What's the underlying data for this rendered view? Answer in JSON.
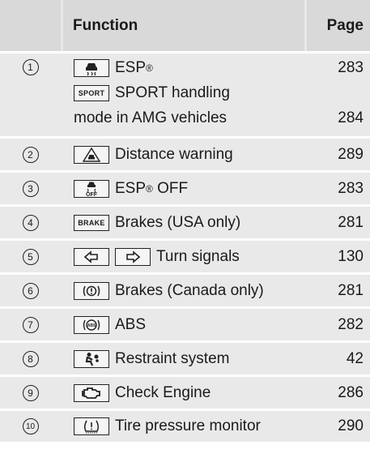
{
  "header": {
    "function": "Function",
    "page": "Page"
  },
  "rows": [
    {
      "num": "1",
      "lines": [
        {
          "icon": "esp-car-icon",
          "text": "ESP",
          "sup": "®"
        },
        {
          "icon": "sport-text-icon",
          "icon_text": "SPORT",
          "text": "SPORT handling"
        },
        {
          "text": "mode in AMG vehicles"
        }
      ],
      "pages": [
        "283",
        "284"
      ]
    },
    {
      "num": "2",
      "text": "Distance warning",
      "page": "289",
      "icon": "distance-warning-icon"
    },
    {
      "num": "3",
      "text": "ESP",
      "sup": "®",
      "text2": " OFF",
      "page": "283",
      "icon": "esp-off-icon"
    },
    {
      "num": "4",
      "text": "Brakes (USA only)",
      "page": "281",
      "icon": "brake-text-icon",
      "icon_text": "BRAKE"
    },
    {
      "num": "5",
      "text": "Turn signals",
      "page": "130",
      "icon": "turn-signal-icons"
    },
    {
      "num": "6",
      "text": "Brakes (Canada only)",
      "page": "281",
      "icon": "brake-circle-icon"
    },
    {
      "num": "7",
      "text": "ABS",
      "page": "282",
      "icon": "abs-icon",
      "icon_text": "ABS"
    },
    {
      "num": "8",
      "text": "Restraint system",
      "page": "42",
      "icon": "restraint-icon"
    },
    {
      "num": "9",
      "text": "Check Engine",
      "page": "286",
      "icon": "engine-icon"
    },
    {
      "num": "10",
      "text": "Tire pressure monitor",
      "page": "290",
      "icon": "tire-pressure-icon"
    }
  ]
}
